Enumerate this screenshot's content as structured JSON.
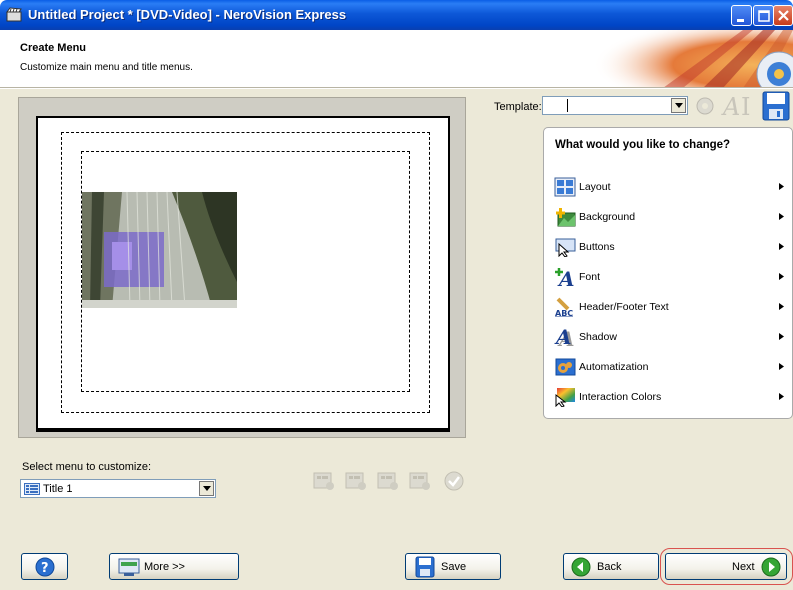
{
  "window": {
    "title": "Untitled Project * [DVD-Video] - NeroVision Express"
  },
  "header": {
    "title": "Create Menu",
    "subtitle": "Customize main menu and title menus."
  },
  "template": {
    "label": "Template:",
    "value": ""
  },
  "panel": {
    "title": "What would you like to change?",
    "items": [
      {
        "label": "Layout",
        "icon": "layout-icon"
      },
      {
        "label": "Background",
        "icon": "background-icon"
      },
      {
        "label": "Buttons",
        "icon": "buttons-icon"
      },
      {
        "label": "Font",
        "icon": "font-icon"
      },
      {
        "label": "Header/Footer Text",
        "icon": "header-footer-text-icon"
      },
      {
        "label": "Shadow",
        "icon": "shadow-icon"
      },
      {
        "label": "Automatization",
        "icon": "automatization-icon"
      },
      {
        "label": "Interaction Colors",
        "icon": "interaction-colors-icon"
      }
    ]
  },
  "menu_select": {
    "label": "Select menu to customize:",
    "value": "Title 1"
  },
  "buttons": {
    "help": "?",
    "more": "More >>",
    "save": "Save",
    "back": "Back",
    "next": "Next"
  },
  "colors": {
    "titlebar": "#0d58d8",
    "dialog_bg": "#ece9d8",
    "highlight": "#d9534f"
  }
}
